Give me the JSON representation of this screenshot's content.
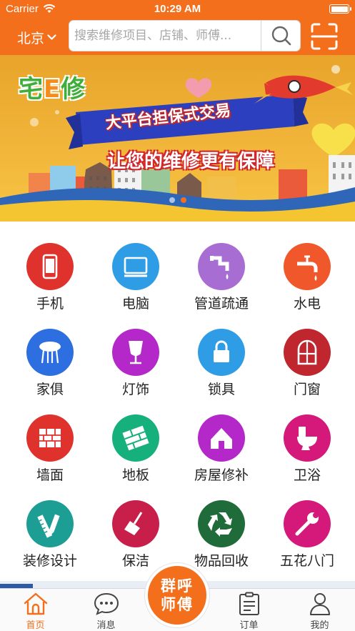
{
  "status_bar": {
    "carrier": "Carrier",
    "time": "10:29 AM"
  },
  "header": {
    "city": "北京",
    "search_placeholder": "搜索维修项目、店铺、师傅..."
  },
  "banner": {
    "logo_prefix": "宅",
    "logo_e": "E",
    "logo_suffix": "修",
    "ribbon_text": "大平台担保式交易",
    "slogan": "让您的维修更有保障",
    "slide_count": 2,
    "active_slide": 1
  },
  "categories": [
    {
      "label": "手机",
      "icon": "phone-icon",
      "color": "#e0322d"
    },
    {
      "label": "电脑",
      "icon": "monitor-icon",
      "color": "#2f9de6"
    },
    {
      "label": "管道疏通",
      "icon": "pipe-icon",
      "color": "#a86dd3"
    },
    {
      "label": "水电",
      "icon": "faucet-icon",
      "color": "#f0572b"
    },
    {
      "label": "家俱",
      "icon": "table-icon",
      "color": "#2d6ee0"
    },
    {
      "label": "灯饰",
      "icon": "lamp-icon",
      "color": "#b428c9"
    },
    {
      "label": "锁具",
      "icon": "lock-icon",
      "color": "#2f9de6"
    },
    {
      "label": "门窗",
      "icon": "window-icon",
      "color": "#c0262e"
    },
    {
      "label": "墙面",
      "icon": "brick-wall-icon",
      "color": "#e0322d"
    },
    {
      "label": "地板",
      "icon": "floor-icon",
      "color": "#16b07c"
    },
    {
      "label": "房屋修补",
      "icon": "house-icon",
      "color": "#b428c9"
    },
    {
      "label": "卫浴",
      "icon": "toilet-icon",
      "color": "#d4197a"
    },
    {
      "label": "装修设计",
      "icon": "ruler-pencil-icon",
      "color": "#1c9e94"
    },
    {
      "label": "保洁",
      "icon": "broom-icon",
      "color": "#c81f4a"
    },
    {
      "label": "物品回收",
      "icon": "recycle-icon",
      "color": "#1f6b3a"
    },
    {
      "label": "五花八门",
      "icon": "wrench-icon",
      "color": "#d4197a"
    }
  ],
  "tabbar": {
    "items": [
      {
        "label": "首页",
        "icon": "home-icon",
        "active": true
      },
      {
        "label": "消息",
        "icon": "message-icon",
        "active": false
      },
      {
        "label": "订单",
        "icon": "order-icon",
        "active": false
      },
      {
        "label": "我的",
        "icon": "profile-icon",
        "active": false
      }
    ],
    "center_line1": "群呼",
    "center_line2": "师傅"
  },
  "colors": {
    "brand": "#f36f1c"
  }
}
